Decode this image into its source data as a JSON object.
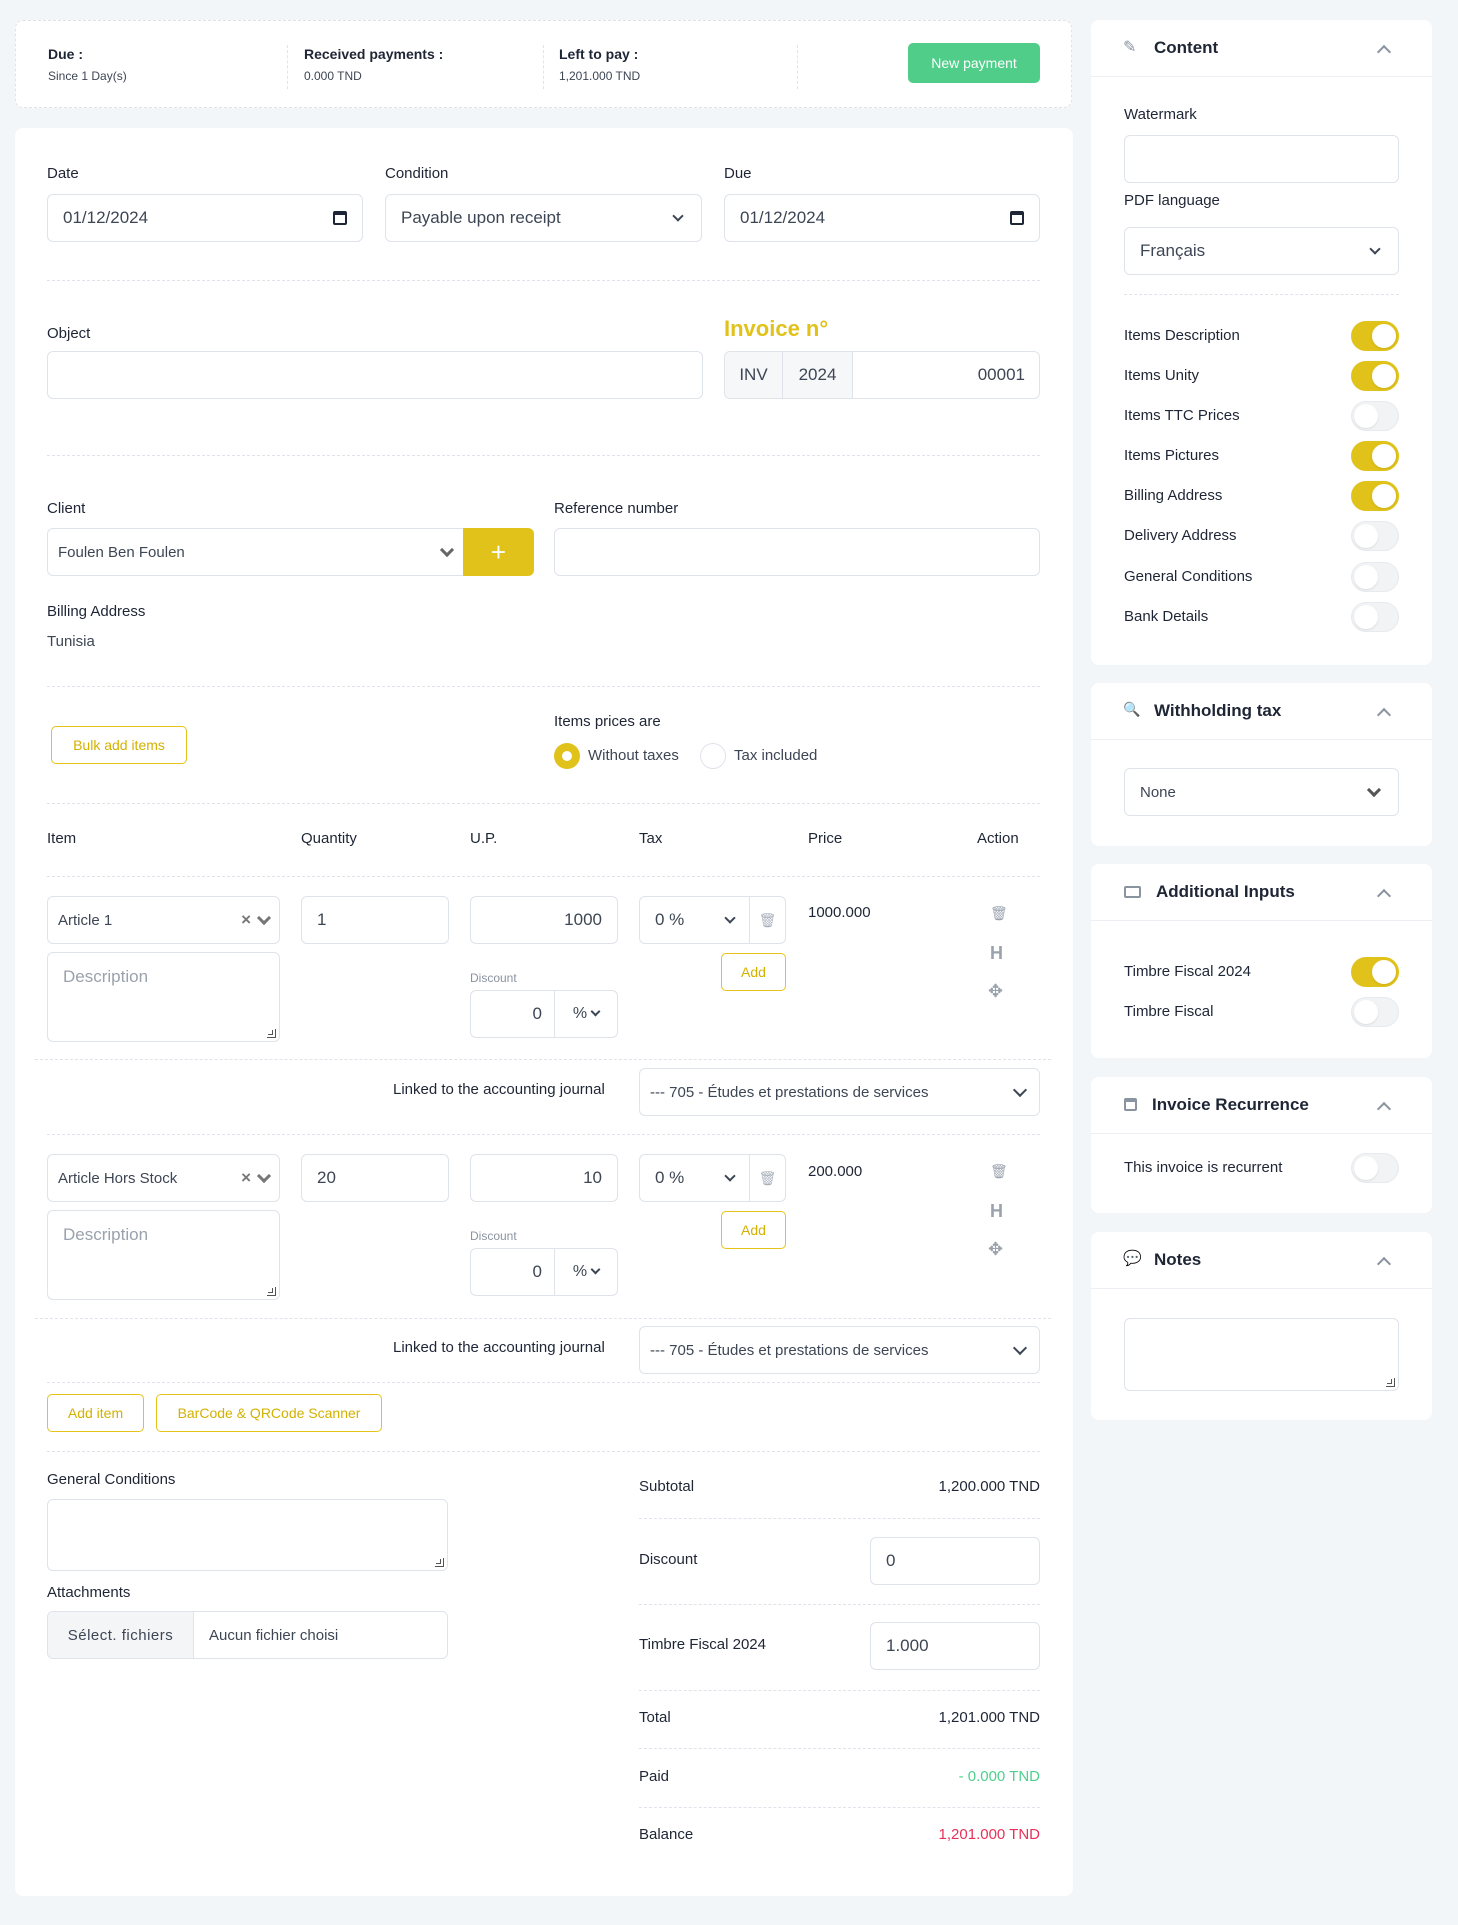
{
  "summary": {
    "due_label": "Due :",
    "due_value": "Since 1 Day(s)",
    "received_label": "Received payments :",
    "received_value": "0.000 TND",
    "left_label": "Left to pay :",
    "left_value": "1,201.000 TND",
    "new_payment": "New payment"
  },
  "form": {
    "date_label": "Date",
    "date_value": "01/12/2024",
    "condition_label": "Condition",
    "condition_value": "Payable upon receipt",
    "due_label": "Due",
    "due_value": "01/12/2024",
    "object_label": "Object",
    "invoice_no_label": "Invoice n°",
    "invoice_prefix": "INV",
    "invoice_year": "2024",
    "invoice_number": "00001",
    "client_label": "Client",
    "client_value": "Foulen Ben Foulen",
    "reference_label": "Reference number",
    "billing_label": "Billing Address",
    "billing_value": "Tunisia",
    "bulk_add": "Bulk add items",
    "prices_label": "Items prices are",
    "without_taxes": "Without taxes",
    "tax_included": "Tax included"
  },
  "table": {
    "headers": [
      "Item",
      "Quantity",
      "U.P.",
      "Tax",
      "Price",
      "Action"
    ],
    "rows": [
      {
        "item": "Article 1",
        "qty": "1",
        "up": "1000",
        "tax": "0 %",
        "discount": "0",
        "discount_type": "%",
        "price": "1000.000",
        "journal": "--- 705 - Études et prestations de services"
      },
      {
        "item": "Article Hors Stock",
        "qty": "20",
        "up": "10",
        "tax": "0 %",
        "discount": "0",
        "discount_type": "%",
        "price": "200.000",
        "journal": "--- 705 - Études et prestations de services"
      }
    ],
    "description_ph": "Description",
    "discount_label": "Discount",
    "add_label": "Add",
    "linked_label": "Linked to the accounting journal",
    "add_item": "Add item",
    "scanner": "BarCode & QRCode Scanner"
  },
  "footer": {
    "general_conditions_label": "General Conditions",
    "attachments_label": "Attachments",
    "file_button": "Sélect. fichiers",
    "file_none": "Aucun fichier choisi",
    "subtotal_label": "Subtotal",
    "subtotal_value": "1,200.000 TND",
    "discount_label": "Discount",
    "discount_value": "0",
    "timbre_label": "Timbre Fiscal 2024",
    "timbre_value": "1.000",
    "total_label": "Total",
    "total_value": "1,201.000 TND",
    "paid_label": "Paid",
    "paid_value": "- 0.000 TND",
    "balance_label": "Balance",
    "balance_value": "1,201.000 TND"
  },
  "sidebar": {
    "content_title": "Content",
    "watermark_label": "Watermark",
    "pdf_language_label": "PDF language",
    "pdf_language_value": "Français",
    "toggles": [
      {
        "label": "Items Description",
        "on": true
      },
      {
        "label": "Items Unity",
        "on": true
      },
      {
        "label": "Items TTC Prices",
        "on": false
      },
      {
        "label": "Items Pictures",
        "on": true
      },
      {
        "label": "Billing Address",
        "on": true
      },
      {
        "label": "Delivery Address",
        "on": false
      },
      {
        "label": "General Conditions",
        "on": false
      },
      {
        "label": "Bank Details",
        "on": false
      }
    ],
    "withholding_title": "Withholding tax",
    "withholding_value": "None",
    "additional_title": "Additional Inputs",
    "additional_toggles": [
      {
        "label": "Timbre Fiscal 2024",
        "on": true
      },
      {
        "label": "Timbre Fiscal",
        "on": false
      }
    ],
    "recurrence_title": "Invoice Recurrence",
    "recurrence_label": "This invoice is recurrent",
    "recurrence_on": false,
    "notes_title": "Notes"
  },
  "colors": {
    "accent": "#e1c21b",
    "success": "#4fcf8d",
    "danger": "#e8305a"
  }
}
